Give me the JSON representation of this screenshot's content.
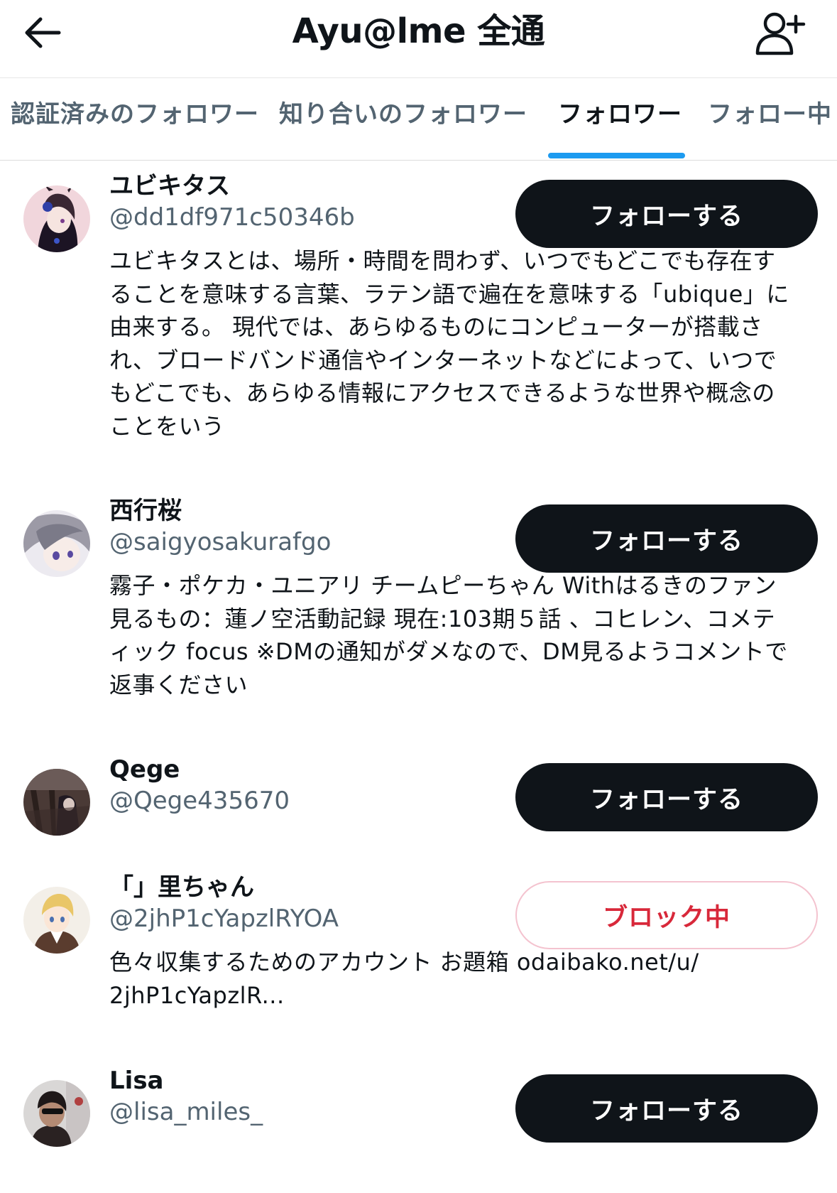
{
  "header": {
    "title": "Ayu@lme 全通",
    "back_icon": "arrow-left-icon",
    "add_icon": "add-user-icon"
  },
  "tabs": [
    {
      "label": "認証済みのフォロワー",
      "active": false
    },
    {
      "label": "知り合いのフォロワー",
      "active": false
    },
    {
      "label": "フォロワー",
      "active": true
    },
    {
      "label": "フォロー中",
      "active": false
    }
  ],
  "users": [
    {
      "name": "ユビキタス",
      "handle": "@dd1df971c50346b",
      "button": "フォローする",
      "bio": [
        "ユビキタスとは、場所・時間を問わず、いつでもどこでも存在す",
        "ることを意味する言葉、ラテン語で遍在を意味する「ubique」に",
        "由来する。 現代では、あらゆるものにコンピューターが搭載さ",
        "れ、ブロードバンド通信やインターネットなどによって、いつで",
        "もどこでも、あらゆる情報にアクセスできるような世界や概念の",
        "ことをいう"
      ]
    },
    {
      "name": "西行桜",
      "handle": "@saigyosakurafgo",
      "button": "フォローする",
      "bio": [
        "霧子・ポケカ・ユニアリ チームピーちゃん Withはるきのファン",
        "見るもの：蓮ノ空活動記録 現在:103期５話 、コヒレン、コメテ",
        "ィック focus ※DMの通知がダメなので、DM見るようコメントで",
        "返事ください"
      ]
    },
    {
      "name": "Qege",
      "handle": "@Qege435670",
      "button": "フォローする",
      "bio": []
    },
    {
      "name": "「」里ちゃん",
      "handle": "@2jhP1cYapzlRYOA",
      "button": "ブロック中",
      "bio": [
        "色々収集するためのアカウント お題箱 odaibako.net/u/",
        "2jhP1cYapzlR..."
      ]
    },
    {
      "name": "Lisa",
      "handle": "@lisa_miles_",
      "button": "フォローする",
      "bio": []
    }
  ],
  "colors": {
    "accent": "#1d9bf0",
    "button_dark": "#0f1419",
    "blocked_text": "#d8283a",
    "secondary_text": "#536471"
  }
}
